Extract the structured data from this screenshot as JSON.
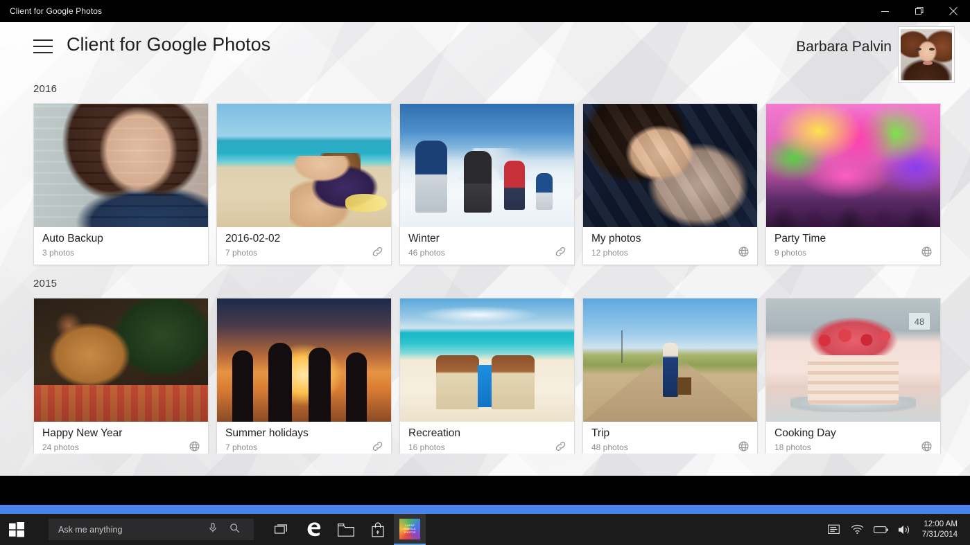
{
  "window": {
    "title": "Client for Google Photos",
    "controls": {
      "minimize": "minimize-button",
      "restore": "restore-button",
      "close": "close-button"
    }
  },
  "header": {
    "menu_label": "hamburger-menu",
    "title": "Client for Google Photos",
    "user_name": "Barbara Palvin",
    "avatar_alt": "Barbara Palvin avatar"
  },
  "sections": [
    {
      "year": "2016",
      "albums": [
        {
          "title": "Auto Backup",
          "count": "3 photos",
          "icon": "none",
          "art": "th-backup"
        },
        {
          "title": "2016-02-02",
          "count": "7 photos",
          "icon": "link",
          "art": "th-beach"
        },
        {
          "title": "Winter",
          "count": "46 photos",
          "icon": "link",
          "art": "th-winter"
        },
        {
          "title": "My photos",
          "count": "12 photos",
          "icon": "globe",
          "art": "th-myphotos"
        },
        {
          "title": "Party Time",
          "count": "9 photos",
          "icon": "globe",
          "art": "th-holi"
        }
      ]
    },
    {
      "year": "2015",
      "albums": [
        {
          "title": "Happy New Year",
          "count": "24 photos",
          "icon": "globe",
          "art": "th-cat"
        },
        {
          "title": "Summer holidays",
          "count": "7 photos",
          "icon": "link",
          "art": "th-sunset"
        },
        {
          "title": "Recreation",
          "count": "16 photos",
          "icon": "link",
          "art": "th-tropic"
        },
        {
          "title": "Trip",
          "count": "48 photos",
          "icon": "globe",
          "art": "th-road"
        },
        {
          "title": "Cooking Day",
          "count": "18 photos",
          "icon": "globe",
          "art": "th-cake"
        }
      ]
    }
  ],
  "command_bar": {
    "background": "#4a82ec",
    "accent": "#cfe84a",
    "buttons": [
      {
        "name": "share-button",
        "icon": "share"
      },
      {
        "name": "select-button",
        "icon": "checklist"
      },
      {
        "name": "refresh-button",
        "icon": "refresh"
      },
      {
        "name": "slideshow-button",
        "icon": "play"
      },
      {
        "name": "add-button",
        "icon": "plus"
      },
      {
        "name": "more-button",
        "icon": "ellipsis"
      }
    ]
  },
  "taskbar": {
    "start": "start-button",
    "search_placeholder": "Ask me anything",
    "icons": [
      "task-view",
      "edge-browser",
      "file-explorer",
      "store"
    ],
    "active_app": "Client for Google Photos",
    "app_logo_text": "CLIENT GOOGLE PHOTOS",
    "tray": [
      "action-center",
      "wifi",
      "battery",
      "volume"
    ],
    "time": "12:00 AM",
    "date": "7/31/2014"
  },
  "cake_tag": "48"
}
